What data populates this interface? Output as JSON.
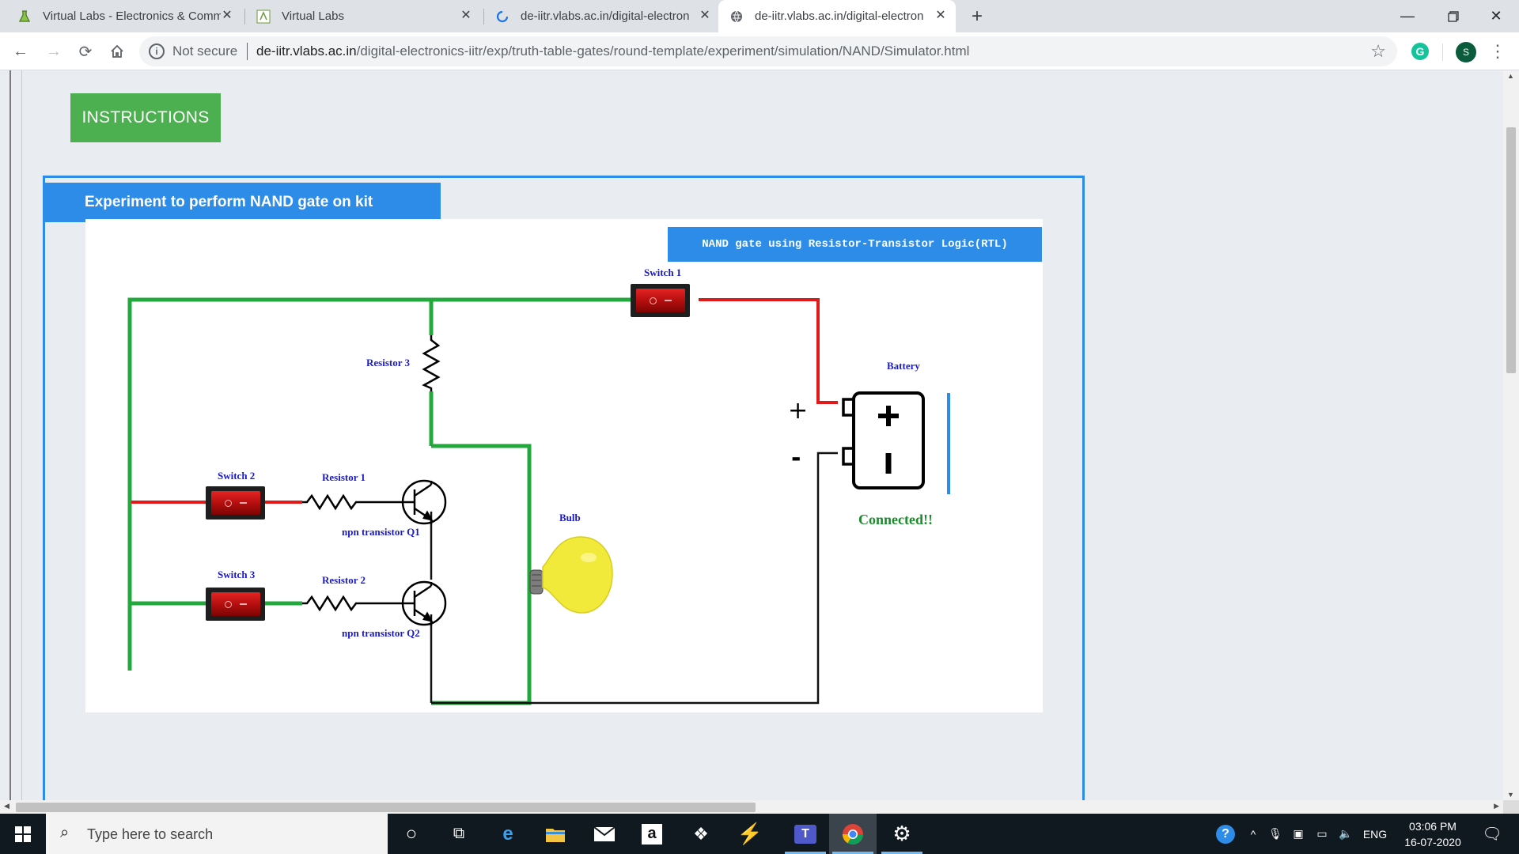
{
  "browser": {
    "tabs": [
      {
        "title": "Virtual Labs - Electronics & Comm",
        "favicon": "flask-icon"
      },
      {
        "title": "Virtual Labs",
        "favicon": "vlabs-logo-icon"
      },
      {
        "title": "de-iitr.vlabs.ac.in/digital-electron",
        "favicon": "loading-spinner-icon"
      },
      {
        "title": "de-iitr.vlabs.ac.in/digital-electron",
        "favicon": "globe-icon"
      }
    ],
    "security_label": "Not secure",
    "url_host": "de-iitr.vlabs.ac.in",
    "url_path": "/digital-electronics-iitr/exp/truth-table-gates/round-template/experiment/simulation/NAND/Simulator.html",
    "extension_badge": "G",
    "profile_initial": "S"
  },
  "page": {
    "instructions_label": "INSTRUCTIONS",
    "experiment_title": "Experiment to perform NAND gate on kit"
  },
  "simulator": {
    "banner": "NAND gate using Resistor-Transistor Logic(RTL)",
    "labels": {
      "switch1": "Switch 1",
      "switch2": "Switch 2",
      "switch3": "Switch 3",
      "resistor1": "Resistor 1",
      "resistor2": "Resistor 2",
      "resistor3": "Resistor 3",
      "q1": "npn transistor Q1",
      "q2": "npn transistor Q2",
      "bulb": "Bulb",
      "battery": "Battery",
      "plus": "+",
      "minus": "-"
    },
    "status": "Connected!!",
    "switch_states": {
      "switch1": "off",
      "switch2": "off",
      "switch3": "off"
    },
    "wire_colors": {
      "high": "#e01a1a",
      "low": "#22a83c",
      "ground": "#111111"
    },
    "bulb_color": "#f2ea3a"
  },
  "taskbar": {
    "search_placeholder": "Type here to search",
    "language": "ENG",
    "time": "03:06 PM",
    "date": "16-07-2020"
  }
}
